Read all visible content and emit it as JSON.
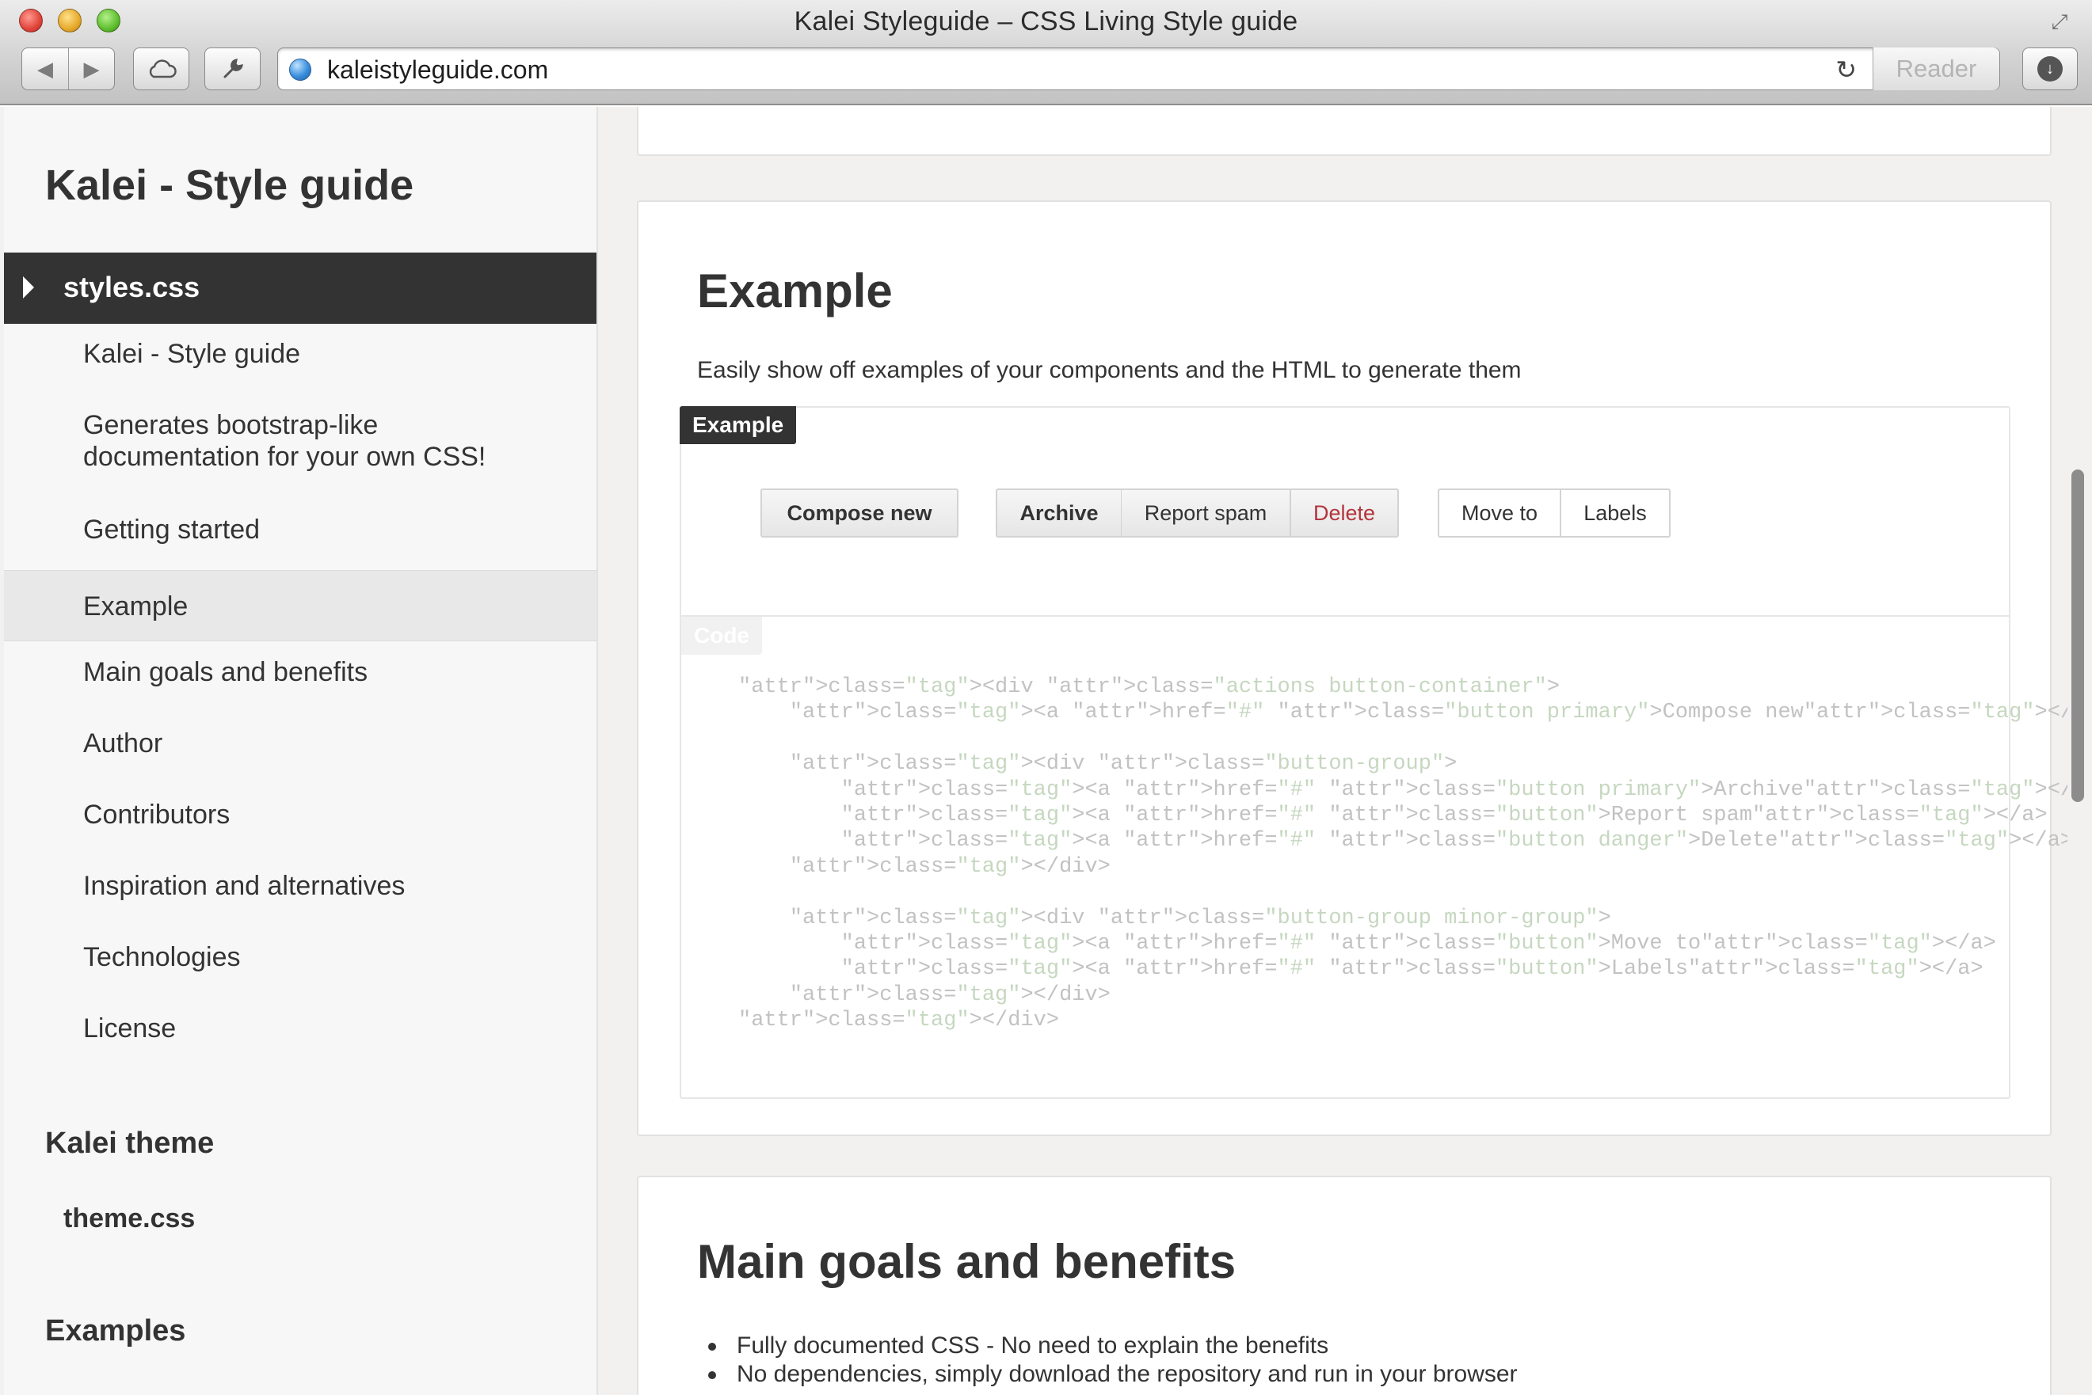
{
  "window": {
    "title": "Kalei Styleguide – CSS Living Style guide",
    "url": "kaleistyleguide.com",
    "reader_label": "Reader"
  },
  "sidebar": {
    "title": "Kalei - Style guide",
    "active_file": "styles.css",
    "items": [
      {
        "label": "Kalei - Style guide"
      },
      {
        "label": "Generates bootstrap-like documentation for your own CSS!"
      },
      {
        "label": "Getting started"
      },
      {
        "label": "Example"
      },
      {
        "label": "Main goals and benefits"
      },
      {
        "label": "Author"
      },
      {
        "label": "Contributors"
      },
      {
        "label": "Inspiration and alternatives"
      },
      {
        "label": "Technologies"
      },
      {
        "label": "License"
      }
    ],
    "section2_heading": "Kalei theme",
    "section2_file": "theme.css",
    "section3_heading": "Examples"
  },
  "example": {
    "heading": "Example",
    "description": "Easily show off examples of your components and the HTML to generate them",
    "example_tag": "Example",
    "code_tag": "Code",
    "buttons": {
      "compose": "Compose new",
      "archive": "Archive",
      "report_spam": "Report spam",
      "delete": "Delete",
      "move_to": "Move to",
      "labels": "Labels"
    },
    "code_lines": [
      "<div class=\"actions button-container\">",
      "    <a href=\"#\" class=\"button primary\">Compose new</a>",
      "",
      "    <div class=\"button-group\">",
      "        <a href=\"#\" class=\"button primary\">Archive</a>",
      "        <a href=\"#\" class=\"button\">Report spam</a>",
      "        <a href=\"#\" class=\"button danger\">Delete</a>",
      "    </div>",
      "",
      "    <div class=\"button-group minor-group\">",
      "        <a href=\"#\" class=\"button\">Move to</a>",
      "        <a href=\"#\" class=\"button\">Labels</a>",
      "    </div>",
      "</div>"
    ]
  },
  "goals": {
    "heading": "Main goals and benefits",
    "bullets": [
      "Fully documented CSS - No need to explain the benefits",
      "No dependencies, simply download the repository and run in your browser"
    ]
  }
}
